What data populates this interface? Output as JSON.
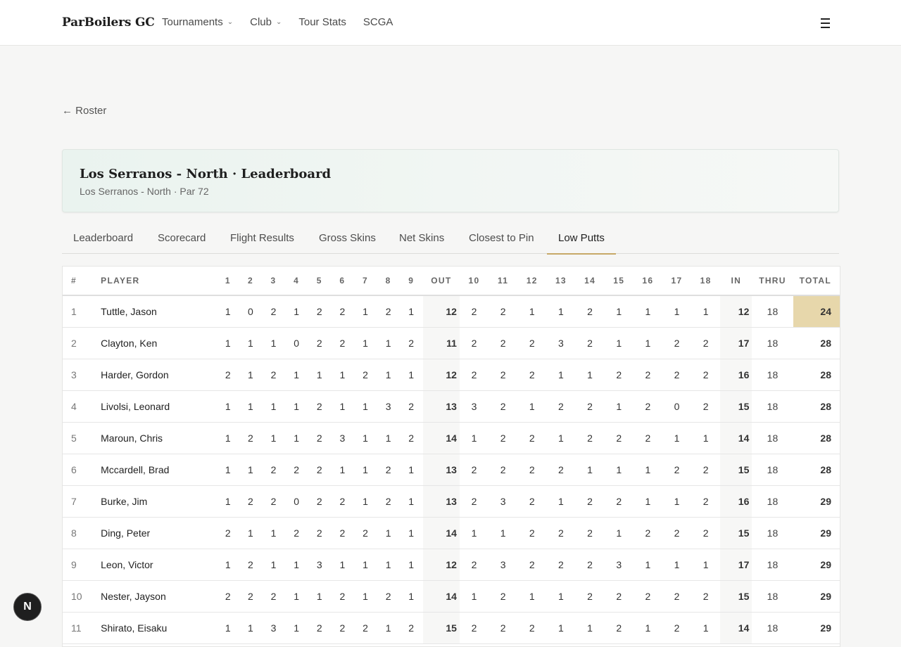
{
  "brand": "ParBoilers GC",
  "nav": {
    "items": [
      {
        "label": "Tournaments",
        "has_dropdown": true
      },
      {
        "label": "Club",
        "has_dropdown": true
      },
      {
        "label": "Tour Stats",
        "has_dropdown": false
      },
      {
        "label": "SCGA",
        "has_dropdown": false
      }
    ]
  },
  "back_link": "← Roster",
  "card": {
    "title": "Los Serranos - North · Leaderboard",
    "subtitle": "Los Serranos - North · Par 72"
  },
  "tabs": [
    {
      "label": "Leaderboard",
      "active": false
    },
    {
      "label": "Scorecard",
      "active": false
    },
    {
      "label": "Flight Results",
      "active": false
    },
    {
      "label": "Gross Skins",
      "active": false
    },
    {
      "label": "Net Skins",
      "active": false
    },
    {
      "label": "Closest to Pin",
      "active": false
    },
    {
      "label": "Low Putts",
      "active": true
    }
  ],
  "table": {
    "headers": [
      "#",
      "PLAYER",
      "1",
      "2",
      "3",
      "4",
      "5",
      "6",
      "7",
      "8",
      "9",
      "OUT",
      "10",
      "11",
      "12",
      "13",
      "14",
      "15",
      "16",
      "17",
      "18",
      "IN",
      "THRU",
      "TOTAL"
    ],
    "rows": [
      {
        "rank": "1",
        "player": "Tuttle, Jason",
        "front": [
          "1",
          "0",
          "2",
          "1",
          "2",
          "2",
          "1",
          "2",
          "1"
        ],
        "out": "12",
        "back": [
          "2",
          "2",
          "1",
          "1",
          "2",
          "1",
          "1",
          "1",
          "1"
        ],
        "in": "12",
        "thru": "18",
        "total": "24",
        "best": true
      },
      {
        "rank": "2",
        "player": "Clayton, Ken",
        "front": [
          "1",
          "1",
          "1",
          "0",
          "2",
          "2",
          "1",
          "1",
          "2"
        ],
        "out": "11",
        "back": [
          "2",
          "2",
          "2",
          "3",
          "2",
          "1",
          "1",
          "2",
          "2"
        ],
        "in": "17",
        "thru": "18",
        "total": "28"
      },
      {
        "rank": "3",
        "player": "Harder, Gordon",
        "front": [
          "2",
          "1",
          "2",
          "1",
          "1",
          "1",
          "2",
          "1",
          "1"
        ],
        "out": "12",
        "back": [
          "2",
          "2",
          "2",
          "1",
          "1",
          "2",
          "2",
          "2",
          "2"
        ],
        "in": "16",
        "thru": "18",
        "total": "28"
      },
      {
        "rank": "4",
        "player": "Livolsi, Leonard",
        "front": [
          "1",
          "1",
          "1",
          "1",
          "2",
          "1",
          "1",
          "3",
          "2"
        ],
        "out": "13",
        "back": [
          "3",
          "2",
          "1",
          "2",
          "2",
          "1",
          "2",
          "0",
          "2"
        ],
        "in": "15",
        "thru": "18",
        "total": "28"
      },
      {
        "rank": "5",
        "player": "Maroun, Chris",
        "front": [
          "1",
          "2",
          "1",
          "1",
          "2",
          "3",
          "1",
          "1",
          "2"
        ],
        "out": "14",
        "back": [
          "1",
          "2",
          "2",
          "1",
          "2",
          "2",
          "2",
          "1",
          "1"
        ],
        "in": "14",
        "thru": "18",
        "total": "28"
      },
      {
        "rank": "6",
        "player": "Mccardell, Brad",
        "front": [
          "1",
          "1",
          "2",
          "2",
          "2",
          "1",
          "1",
          "2",
          "1"
        ],
        "out": "13",
        "back": [
          "2",
          "2",
          "2",
          "2",
          "1",
          "1",
          "1",
          "2",
          "2"
        ],
        "in": "15",
        "thru": "18",
        "total": "28"
      },
      {
        "rank": "7",
        "player": "Burke, Jim",
        "front": [
          "1",
          "2",
          "2",
          "0",
          "2",
          "2",
          "1",
          "2",
          "1"
        ],
        "out": "13",
        "back": [
          "2",
          "3",
          "2",
          "1",
          "2",
          "2",
          "1",
          "1",
          "2"
        ],
        "in": "16",
        "thru": "18",
        "total": "29"
      },
      {
        "rank": "8",
        "player": "Ding, Peter",
        "front": [
          "2",
          "1",
          "1",
          "2",
          "2",
          "2",
          "2",
          "1",
          "1"
        ],
        "out": "14",
        "back": [
          "1",
          "1",
          "2",
          "2",
          "2",
          "1",
          "2",
          "2",
          "2"
        ],
        "in": "15",
        "thru": "18",
        "total": "29"
      },
      {
        "rank": "9",
        "player": "Leon, Victor",
        "front": [
          "1",
          "2",
          "1",
          "1",
          "3",
          "1",
          "1",
          "1",
          "1"
        ],
        "out": "12",
        "back": [
          "2",
          "3",
          "2",
          "2",
          "2",
          "3",
          "1",
          "1",
          "1"
        ],
        "in": "17",
        "thru": "18",
        "total": "29"
      },
      {
        "rank": "10",
        "player": "Nester, Jayson",
        "front": [
          "2",
          "2",
          "2",
          "1",
          "1",
          "2",
          "1",
          "2",
          "1"
        ],
        "out": "14",
        "back": [
          "1",
          "2",
          "1",
          "1",
          "2",
          "2",
          "2",
          "2",
          "2"
        ],
        "in": "15",
        "thru": "18",
        "total": "29"
      },
      {
        "rank": "11",
        "player": "Shirato, Eisaku",
        "front": [
          "1",
          "1",
          "3",
          "1",
          "2",
          "2",
          "2",
          "1",
          "2"
        ],
        "out": "15",
        "back": [
          "2",
          "2",
          "2",
          "1",
          "1",
          "2",
          "1",
          "2",
          "1"
        ],
        "in": "14",
        "thru": "18",
        "total": "29"
      }
    ]
  },
  "badge": "N",
  "colors": {
    "accent": "#c7a968",
    "best_total_bg": "#e7d7ab"
  }
}
